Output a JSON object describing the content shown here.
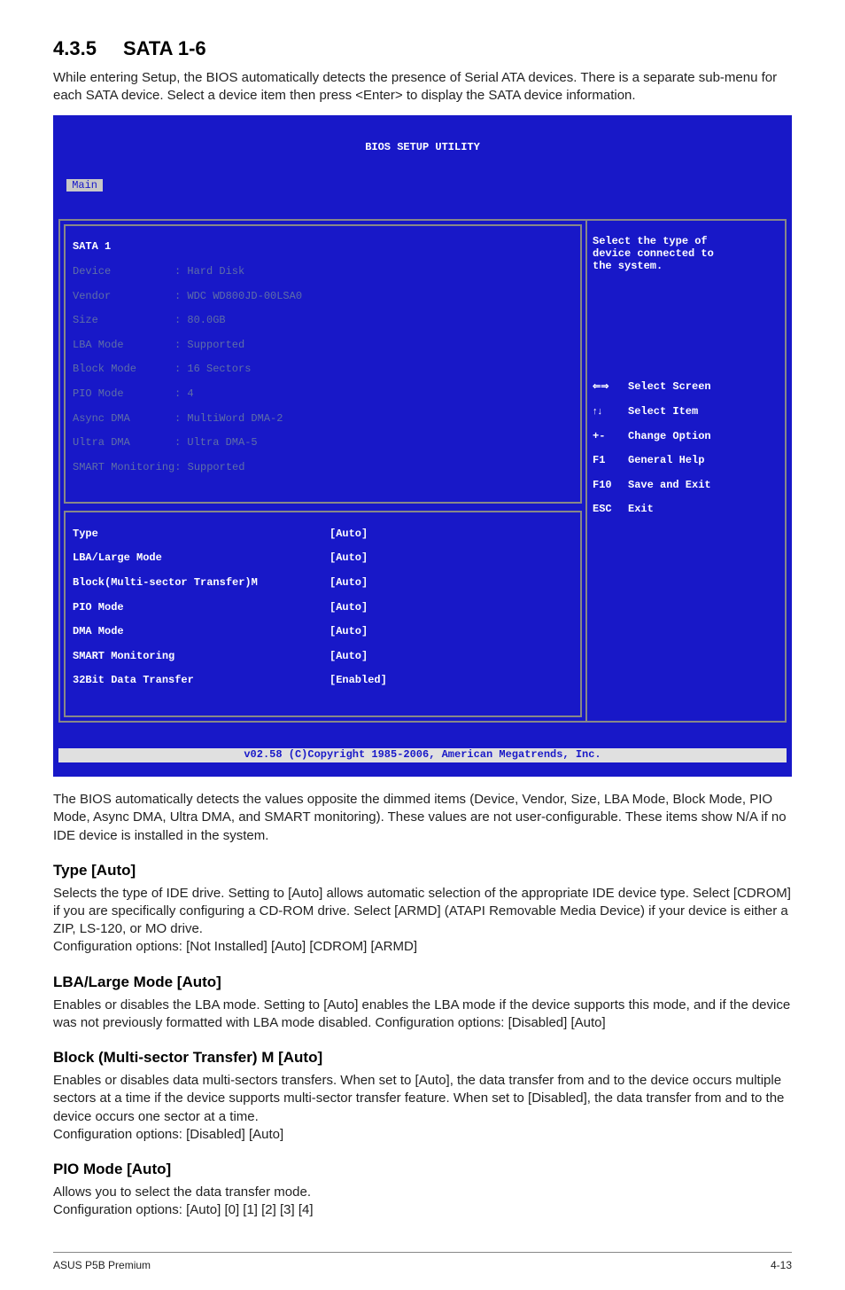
{
  "section": {
    "num": "4.3.5",
    "title": "SATA 1-6"
  },
  "intro": "While entering Setup, the BIOS automatically detects the presence of Serial ATA devices. There is a separate sub-menu for each SATA device. Select a device item then press <Enter> to display the SATA device information.",
  "bios": {
    "title": "BIOS SETUP UTILITY",
    "tab": "Main",
    "menu_header": "SATA 1",
    "dim": {
      "device": {
        "label": "Device",
        "val": ": Hard Disk"
      },
      "vendor": {
        "label": "Vendor",
        "val": ": WDC WD800JD-00LSA0"
      },
      "size": {
        "label": "Size",
        "val": ": 80.0GB"
      },
      "lba": {
        "label": "LBA Mode",
        "val": ": Supported"
      },
      "block": {
        "label": "Block Mode",
        "val": ": 16 Sectors"
      },
      "pio": {
        "label": "PIO Mode",
        "val": ": 4"
      },
      "async": {
        "label": "Async DMA",
        "val": ": MultiWord DMA-2"
      },
      "ultra": {
        "label": "Ultra DMA",
        "val": ": Ultra DMA-5"
      },
      "smart": {
        "label": "SMART Monitoring: Supported",
        "val": ""
      }
    },
    "cfg": {
      "type": {
        "label": "Type",
        "val": "[Auto]"
      },
      "lba": {
        "label": "LBA/Large Mode",
        "val": "[Auto]"
      },
      "block": {
        "label": "Block(Multi-sector Transfer)M",
        "val": "[Auto]"
      },
      "pio": {
        "label": "PIO Mode",
        "val": "[Auto]"
      },
      "dma": {
        "label": "DMA Mode",
        "val": "[Auto]"
      },
      "smart": {
        "label": "SMART Monitoring",
        "val": "[Auto]"
      },
      "bits": {
        "label": "32Bit Data Transfer",
        "val": "[Enabled]"
      }
    },
    "rhelp_top": "Select the type of\ndevice connected to\nthe system.",
    "keys": {
      "k1": {
        "k": "⇐⇒",
        "t": "Select Screen"
      },
      "k2": {
        "k": "↑↓",
        "t": "Select Item"
      },
      "k3": {
        "k": "+-",
        "t": "Change Option"
      },
      "k4": {
        "k": "F1",
        "t": "General Help"
      },
      "k5": {
        "k": "F10",
        "t": "Save and Exit"
      },
      "k6": {
        "k": "ESC",
        "t": "Exit"
      }
    },
    "footer": "v02.58 (C)Copyright 1985-2006, American Megatrends, Inc."
  },
  "after_bios": "The BIOS automatically detects the values opposite the dimmed items (Device, Vendor, Size, LBA Mode, Block Mode, PIO Mode, Async DMA, Ultra DMA, and SMART monitoring). These values are not user-configurable. These items show N/A if no IDE device is installed in the system.",
  "type": {
    "h": "Type [Auto]",
    "p1": "Selects the type of IDE drive. Setting to [Auto] allows automatic selection of the appropriate IDE device type. Select [CDROM] if you are specifically configuring a CD-ROM drive. Select [ARMD] (ATAPI Removable Media Device) if your device is either a ZIP, LS-120, or MO drive.",
    "p2": "Configuration options: [Not Installed] [Auto] [CDROM] [ARMD]"
  },
  "lba": {
    "h": "LBA/Large Mode [Auto]",
    "p": "Enables or disables the LBA mode. Setting to [Auto] enables the LBA mode if the device supports this mode, and if the device was not previously formatted with LBA mode disabled. Configuration options: [Disabled] [Auto]"
  },
  "block": {
    "h": "Block (Multi-sector Transfer) M [Auto]",
    "p1": "Enables or disables data multi-sectors transfers. When set to [Auto], the data transfer from and to the device occurs multiple sectors at a time if the device supports multi-sector transfer feature. When set to [Disabled], the data transfer from and to the device occurs one sector at a time.",
    "p2": "Configuration options: [Disabled] [Auto]"
  },
  "pio": {
    "h": "PIO Mode [Auto]",
    "p1": "Allows you to select the data transfer mode.",
    "p2": "Configuration options: [Auto] [0] [1] [2] [3] [4]"
  },
  "foot": {
    "left": "ASUS P5B Premium",
    "right": "4-13"
  }
}
